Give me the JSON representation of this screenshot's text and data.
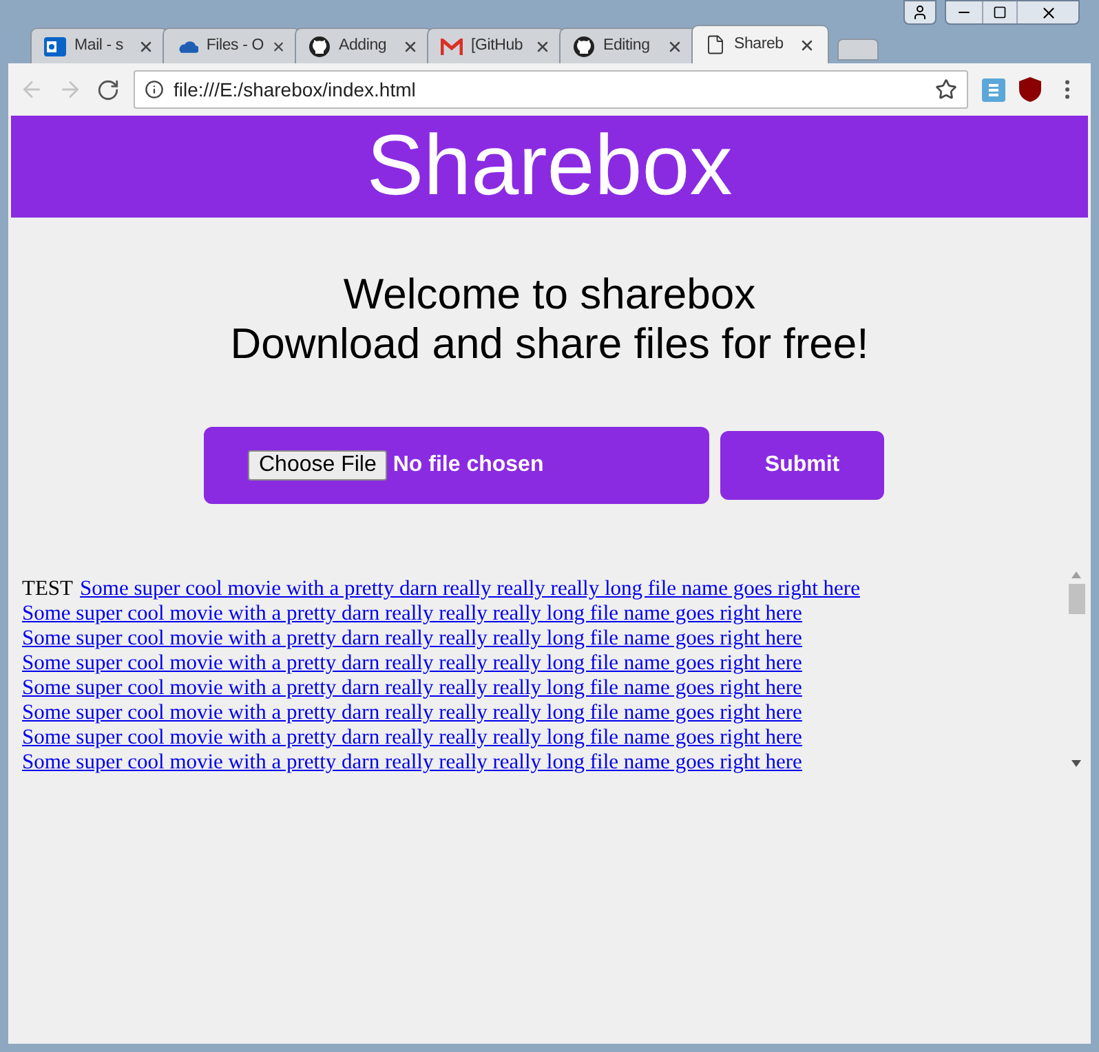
{
  "tabs": [
    {
      "title": "Mail - s",
      "kind": "mail",
      "selected": false
    },
    {
      "title": "Files - O",
      "kind": "cloud",
      "selected": false
    },
    {
      "title": "Adding",
      "kind": "github",
      "selected": false
    },
    {
      "title": "[GitHub",
      "kind": "gmail",
      "selected": false
    },
    {
      "title": "Editing",
      "kind": "github",
      "selected": false
    },
    {
      "title": "Shareb",
      "kind": "page",
      "selected": true
    }
  ],
  "address": "file:///E:/sharebox/index.html",
  "header": {
    "title": "Sharebox"
  },
  "welcome": [
    "Welcome to sharebox",
    "Download and share files for free!"
  ],
  "upload": {
    "choose_button": "Choose File",
    "status": "No file chosen",
    "submit": "Submit"
  },
  "files": [
    {
      "prefix": "TEST",
      "link": "Some super cool movie with a pretty darn really really really long file name goes right here"
    },
    {
      "link": "Some super cool movie with a pretty darn really really really long file name goes right here"
    },
    {
      "link": "Some super cool movie with a pretty darn really really really long file name goes right here"
    },
    {
      "link": "Some super cool movie with a pretty darn really really really long file name goes right here"
    },
    {
      "link": "Some super cool movie with a pretty darn really really really long file name goes right here"
    },
    {
      "link": "Some super cool movie with a pretty darn really really really long file name goes right here"
    },
    {
      "link": "Some super cool movie with a pretty darn really really really long file name goes right here"
    },
    {
      "link": "Some super cool movie with a pretty darn really really really long file name goes right here"
    }
  ]
}
